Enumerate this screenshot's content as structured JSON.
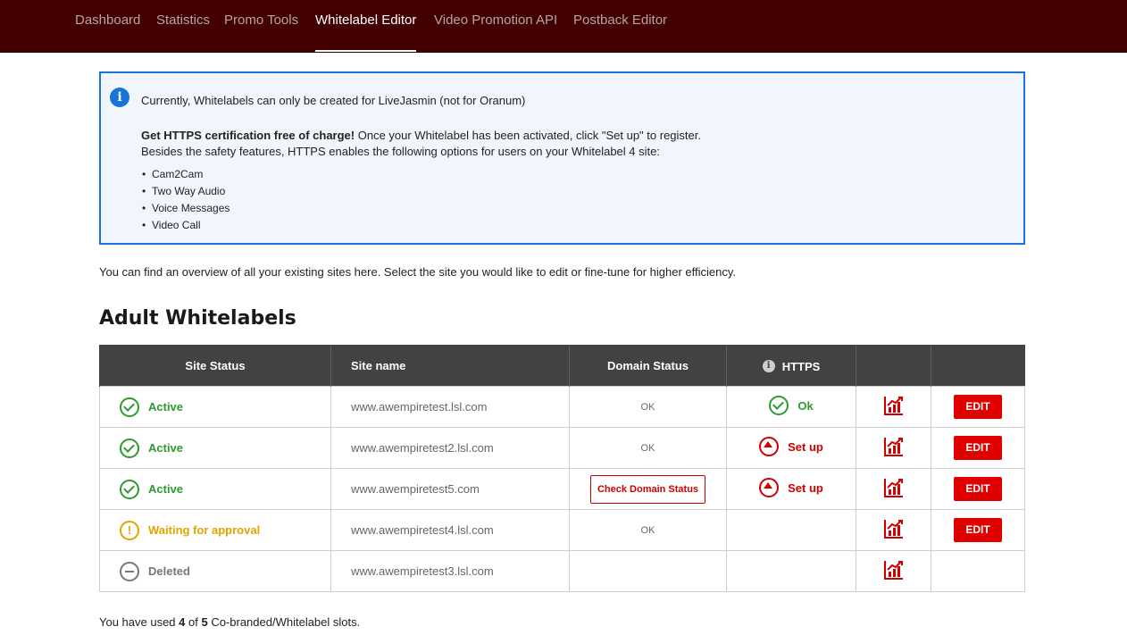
{
  "nav": {
    "items": [
      {
        "label": "Dashboard",
        "active": false
      },
      {
        "label": "Statistics",
        "active": false
      },
      {
        "label": "Promo Tools",
        "active": false
      },
      {
        "label": "Whitelabel Editor",
        "active": true
      },
      {
        "label": "Video Promotion API",
        "active": false
      },
      {
        "label": "Postback Editor",
        "active": false
      }
    ]
  },
  "info_box": {
    "icon": "info-icon",
    "line1": "Currently, Whitelabels can only be created for LiveJasmin (not for Oranum)",
    "line2_bold": "Get HTTPS certification free of charge!",
    "line2_rest": " Once your Whitelabel has been activated, click \"Set up\" to register.",
    "line3": "Besides the safety features, HTTPS enables the following options for users on your Whitelabel 4 site:",
    "features": [
      "Cam2Cam",
      "Two Way Audio",
      "Voice Messages",
      "Video Call"
    ]
  },
  "overview_text": "You can find an overview of all your existing sites here. Select the site you would like to edit or fine-tune for higher efficiency.",
  "section_title": "Adult Whitelabels",
  "table": {
    "headers": {
      "status": "Site Status",
      "site": "Site name",
      "domain": "Domain Status",
      "https": "HTTPS",
      "stats": "",
      "edit": ""
    },
    "rows": [
      {
        "status": "Active",
        "site": "www.awempiretest.lsl.com",
        "domain": "OK",
        "https": "Ok",
        "edit": "EDIT"
      },
      {
        "status": "Active",
        "site": "www.awempiretest2.lsl.com",
        "domain": "OK",
        "https": "Set up",
        "edit": "EDIT"
      },
      {
        "status": "Active",
        "site": "www.awempiretest5.com",
        "domain": "Check Domain Status",
        "https": "Set up",
        "edit": "EDIT"
      },
      {
        "status": "Waiting for approval",
        "site": "www.awempiretest4.lsl.com",
        "domain": "OK",
        "https": "",
        "edit": "EDIT"
      },
      {
        "status": "Deleted",
        "site": "www.awempiretest3.lsl.com",
        "domain": "",
        "https": "",
        "edit": ""
      }
    ]
  },
  "slots": {
    "prefix": "You have used ",
    "used": "4",
    "mid": " of ",
    "total": "5",
    "suffix": " Co-branded/Whitelabel slots."
  },
  "colors": {
    "nav_bg": "#420000",
    "info_border": "#1a73d8",
    "info_bg": "#f1f6fc",
    "table_header": "#424242",
    "active": "#2d9b2d",
    "waiting": "#e3a300",
    "deleted": "#777777",
    "accent_red": "#e00000"
  }
}
